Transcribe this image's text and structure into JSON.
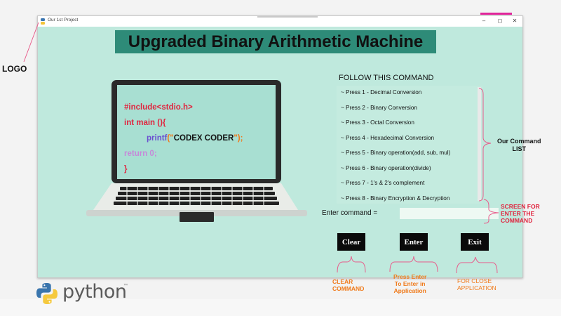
{
  "window": {
    "title": "Our 1st Project",
    "minimize": "–",
    "maximize": "◻",
    "close": "✕"
  },
  "heading": "Upgraded Binary Arithmetic Machine",
  "laptop_screen": {
    "line1": "#include<stdio.h>",
    "line2": "int main (){",
    "line3_func": "printf",
    "line3_paren_open": "(\"",
    "line3_text": "CODEX CODER",
    "line3_paren_close": "\");",
    "line4": "return 0;",
    "line5": "}"
  },
  "commands": {
    "heading": "FOLLOW THIS COMMAND",
    "items": [
      "~ Press 1 - Decimal Conversion",
      "~ Press 2 - Binary Conversion",
      "~ Press 3 - Octal Conversion",
      "~ Press 4 - Hexadecimal Conversion",
      "~ Press 5 - Binary operation(add, sub, mul)",
      "~ Press 6 - Binary operation(divide)",
      "~ Press 7 - 1's & 2's complement",
      "~ Press 8 - Binary Encryption & Decryption"
    ]
  },
  "input": {
    "label": "Enter command =",
    "value": ""
  },
  "buttons": {
    "clear": "Clear",
    "enter": "Enter",
    "exit": "Exit"
  },
  "annotations": {
    "logo": "LOGO",
    "command_list": [
      "Our Command",
      "LIST"
    ],
    "screen": [
      "SCREEN FOR",
      "ENTER THE",
      "COMMAND"
    ],
    "clear": [
      "CLEAR",
      "COMMAND"
    ],
    "enter": [
      "Press Enter",
      "To Enter in",
      "Application"
    ],
    "exit": [
      "FOR CLOSE",
      "APPLICATION"
    ]
  },
  "python_logo_text": "python",
  "python_tm": "™",
  "colors": {
    "window_bg": "#bfe9dd",
    "heading_bg": "#2e8b78",
    "annotation_orange": "#f07a1a",
    "annotation_red": "#e0253f",
    "annotation_line": "#e85b8a",
    "code_red": "#e0253f",
    "code_purple": "#6a4fd0",
    "code_orange": "#f07a1a",
    "code_pink": "#c58ad8"
  }
}
